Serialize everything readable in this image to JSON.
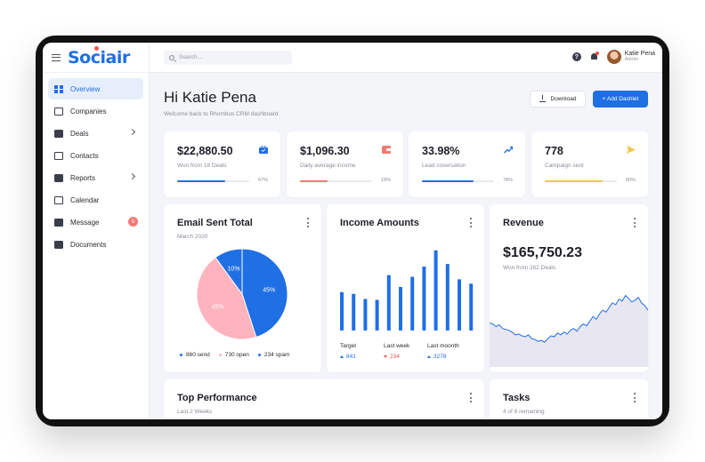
{
  "brand": {
    "name": "Sociair"
  },
  "sidebar": {
    "items": [
      {
        "label": "Overview"
      },
      {
        "label": "Companies"
      },
      {
        "label": "Deals"
      },
      {
        "label": "Contacts"
      },
      {
        "label": "Reports"
      },
      {
        "label": "Calendar"
      },
      {
        "label": "Message",
        "badge": "5"
      },
      {
        "label": "Documents"
      }
    ]
  },
  "topbar": {
    "search_placeholder": "Search...",
    "user_name": "Katie Pena",
    "user_role": "Admin"
  },
  "header": {
    "greeting": "Hi Katie Pena",
    "subtitle": "Welcome back to Rhombus CRM dashboard",
    "download_label": "Download",
    "add_label": "+ Add Dashlet"
  },
  "stats": [
    {
      "value": "$22,880.50",
      "label": "Won from 18 Deals",
      "pct": "67%",
      "fraction": 0.67,
      "color": "#1f6fe5",
      "icon": "briefcase-icon"
    },
    {
      "value": "$1,096.30",
      "label": "Daily average income",
      "pct": "18%",
      "fraction": 0.38,
      "color": "#f27a72",
      "icon": "wallet-icon"
    },
    {
      "value": "33.98%",
      "label": "Lead coversation",
      "pct": "78%",
      "fraction": 0.72,
      "color": "#1f6fe5",
      "icon": "trend-up-icon"
    },
    {
      "value": "778",
      "label": "Campaign sent",
      "pct": "80%",
      "fraction": 0.8,
      "color": "#f5c646",
      "icon": "send-icon"
    }
  ],
  "email_card": {
    "title": "Email Sent Total",
    "subtitle": "March 2020",
    "slice_labels": [
      "45%",
      "45%",
      "10%"
    ],
    "legend": [
      {
        "label": "860 send",
        "color": "#1f6fe5"
      },
      {
        "label": "730 open",
        "color": "#ffb3bd"
      },
      {
        "label": "234 spam",
        "color": "#1f6fe5"
      }
    ]
  },
  "income_card": {
    "title": "Income Amounts",
    "labels": [
      "Target",
      "Last week",
      "Last moonth"
    ],
    "values": [
      "841",
      "234",
      "3278"
    ],
    "directions": [
      "up",
      "down",
      "up"
    ]
  },
  "revenue_card": {
    "title": "Revenue",
    "value": "$165,750.23",
    "subtitle": "Won from 262 Deals"
  },
  "top_card": {
    "title": "Top Performance",
    "subtitle": "Last 2 Weeks"
  },
  "tasks_card": {
    "title": "Tasks",
    "subtitle": "4 of 8 remaining"
  },
  "chart_data": [
    {
      "type": "pie",
      "title": "Email Sent Total",
      "categories": [
        "send",
        "open",
        "spam"
      ],
      "values": [
        45,
        45,
        10
      ],
      "colors": [
        "#1f6fe5",
        "#ffb3bd",
        "#1f6fe5"
      ]
    },
    {
      "type": "bar",
      "title": "Income Amounts",
      "categories": [
        "1",
        "2",
        "3",
        "4",
        "5",
        "6",
        "7",
        "8",
        "9",
        "10",
        "11",
        "12",
        "13",
        "14"
      ],
      "values": [
        45,
        43,
        37,
        36,
        65,
        51,
        63,
        75,
        94,
        78,
        60,
        55
      ],
      "ylim": [
        0,
        100
      ],
      "color": "#1f6fe5"
    },
    {
      "type": "area",
      "title": "Revenue",
      "values": [
        48,
        47,
        44,
        46,
        42,
        41,
        40,
        38,
        35,
        36,
        34,
        33,
        35,
        31,
        30,
        28,
        29,
        27,
        31,
        34,
        33,
        37,
        35,
        38,
        36,
        40,
        42,
        39,
        44,
        47,
        45,
        50,
        55,
        52,
        58,
        62,
        60,
        65,
        70,
        68,
        74,
        72,
        78,
        75,
        71,
        73,
        76,
        70,
        67,
        62
      ],
      "ylim": [
        0,
        100
      ],
      "grid": false,
      "color": "#1f6fe5"
    }
  ]
}
